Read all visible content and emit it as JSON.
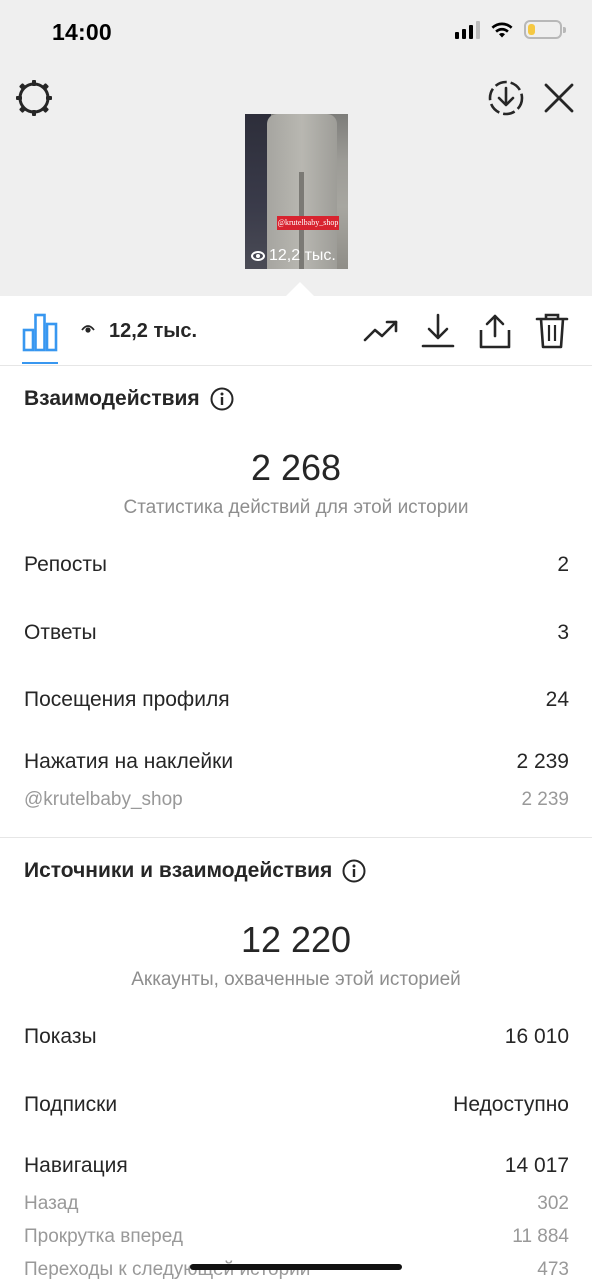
{
  "status_bar": {
    "time": "14:00",
    "battery_level": 0.2
  },
  "toolbar": {
    "settings_icon": "gear-icon",
    "download_icon": "download-circle-icon",
    "close_icon": "close-icon"
  },
  "story_preview": {
    "sticker_text": "@krutelbaby_shop",
    "views": "12,2 тыс."
  },
  "tabs": {
    "insights_icon": "bar-chart-icon",
    "views_label": "12,2 тыс.",
    "actions": [
      "trend-icon",
      "download-icon",
      "share-icon",
      "trash-icon"
    ]
  },
  "interactions": {
    "title": "Взаимодействия",
    "total": "2 268",
    "subtitle": "Статистика действий для этой истории",
    "rows": [
      {
        "label": "Репосты",
        "value": "2"
      },
      {
        "label": "Ответы",
        "value": "3"
      },
      {
        "label": "Посещения профиля",
        "value": "24"
      },
      {
        "label": "Нажатия на наклейки",
        "value": "2 239"
      }
    ],
    "sticker_row": {
      "label": "@krutelbaby_shop",
      "value": "2 239"
    }
  },
  "discovery": {
    "title": "Источники и взаимодействия",
    "total": "12 220",
    "subtitle": "Аккаунты, охваченные этой историей",
    "rows": [
      {
        "label": "Показы",
        "value": "16 010"
      },
      {
        "label": "Подписки",
        "value": "Недоступно"
      },
      {
        "label": "Навигация",
        "value": "14 017"
      }
    ],
    "navigation_rows": [
      {
        "label": "Назад",
        "value": "302"
      },
      {
        "label": "Прокрутка вперед",
        "value": "11 884"
      },
      {
        "label": "Переходы к следующей истории",
        "value": "473"
      }
    ]
  },
  "colors": {
    "accent": "#3897f0",
    "sticker": "#d8232f"
  }
}
